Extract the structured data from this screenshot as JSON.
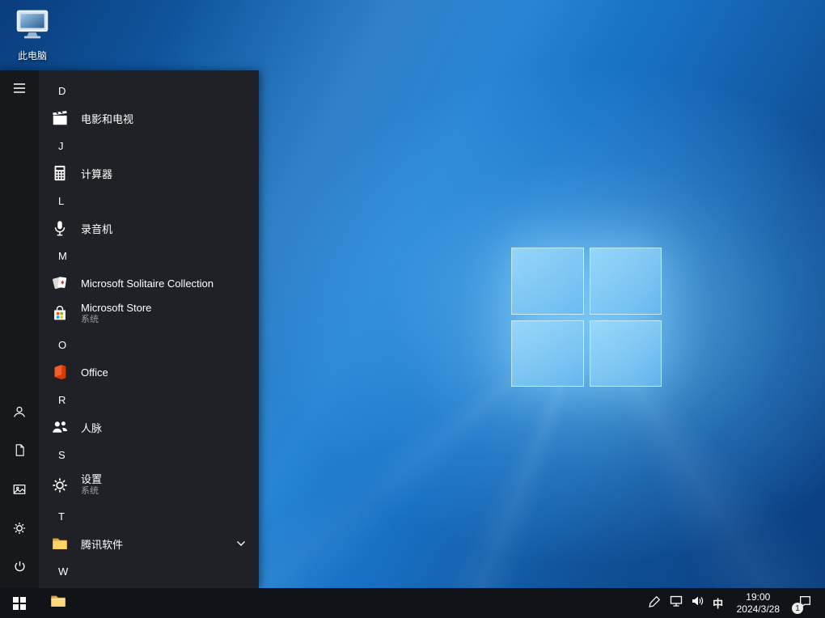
{
  "desktop": {
    "icons": [
      {
        "label": "此电脑",
        "icon": "this-pc-icon"
      }
    ]
  },
  "start_menu": {
    "rail": {
      "items": [
        {
          "icon": "hamburger-icon"
        },
        {
          "icon": "user-icon"
        },
        {
          "icon": "document-icon"
        },
        {
          "icon": "pictures-icon"
        },
        {
          "icon": "gear-icon"
        },
        {
          "icon": "power-icon"
        }
      ]
    },
    "sections": [
      {
        "letter": "D",
        "apps": [
          {
            "name": "电影和电视",
            "icon": "movies-tv-icon"
          }
        ]
      },
      {
        "letter": "J",
        "apps": [
          {
            "name": "计算器",
            "icon": "calculator-icon"
          }
        ]
      },
      {
        "letter": "L",
        "apps": [
          {
            "name": "录音机",
            "icon": "voice-recorder-icon"
          }
        ]
      },
      {
        "letter": "M",
        "apps": [
          {
            "name": "Microsoft Solitaire Collection",
            "icon": "solitaire-icon"
          },
          {
            "name": "Microsoft Store",
            "subtitle": "系统",
            "icon": "store-icon"
          }
        ]
      },
      {
        "letter": "O",
        "apps": [
          {
            "name": "Office",
            "icon": "office-icon"
          }
        ]
      },
      {
        "letter": "R",
        "apps": [
          {
            "name": "人脉",
            "icon": "people-icon"
          }
        ]
      },
      {
        "letter": "S",
        "apps": [
          {
            "name": "设置",
            "subtitle": "系统",
            "icon": "settings-icon"
          }
        ]
      },
      {
        "letter": "T",
        "apps": [
          {
            "name": "腾讯软件",
            "icon": "folder-icon",
            "expandable": true
          }
        ]
      },
      {
        "letter": "W",
        "apps": []
      }
    ]
  },
  "taskbar": {
    "start": {
      "icon": "windows-logo-icon"
    },
    "pinned": [
      {
        "icon": "file-explorer-icon"
      }
    ],
    "tray": {
      "icons": [
        "pen-icon",
        "network-icon",
        "volume-icon"
      ],
      "input_method": "中",
      "time": "19:00",
      "date": "2024/3/28",
      "action_center_badge": "1"
    }
  },
  "colors": {
    "taskbar": "#101318",
    "start_menu": "#1f2126",
    "wallpaper_bright": "#1e7fd2",
    "wallpaper_dark": "#0a3c7c",
    "logo_pane": "#8fd2f5"
  }
}
